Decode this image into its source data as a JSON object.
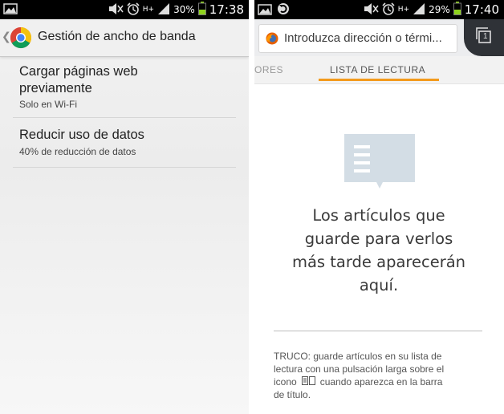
{
  "left": {
    "status_bar": {
      "battery": "30%",
      "time": "17:38",
      "network": "H+"
    },
    "app_bar": {
      "title": "Gestión de ancho de banda"
    },
    "settings": [
      {
        "title_line1": "Cargar páginas web",
        "title_line2": "previamente",
        "summary": "Solo en Wi-Fi"
      },
      {
        "title_line1": "Reducir uso de datos",
        "summary": "40% de reducción de datos"
      }
    ]
  },
  "right": {
    "status_bar": {
      "battery": "29%",
      "time": "17:40",
      "network": "H+"
    },
    "url_bar": {
      "placeholder": "Introduzca dirección o térmi..."
    },
    "tab_count": "1",
    "tabs": [
      {
        "label": "ORES"
      },
      {
        "label": "LISTA DE LECTURA",
        "active": true
      }
    ],
    "accent_color": "#f39a1c",
    "empty_state": {
      "lines": [
        "Los artículos que",
        "guarde para verlos",
        "más tarde aparecerán",
        "aquí."
      ]
    },
    "tip": {
      "line1": "TRUCO: guarde artículos en su lista de",
      "line2": "lectura con una pulsación larga sobre el",
      "line3_before": "icono",
      "line3_after": "cuando aparezca en la barra",
      "line4": "de título."
    }
  },
  "icons": [
    "picture-icon",
    "sync-icon",
    "mute-icon",
    "alarm-icon",
    "signal-icon",
    "battery-icon",
    "chrome-logo-icon",
    "firefox-logo-icon",
    "tabs-counter-icon",
    "reading-list-book-icon"
  ]
}
